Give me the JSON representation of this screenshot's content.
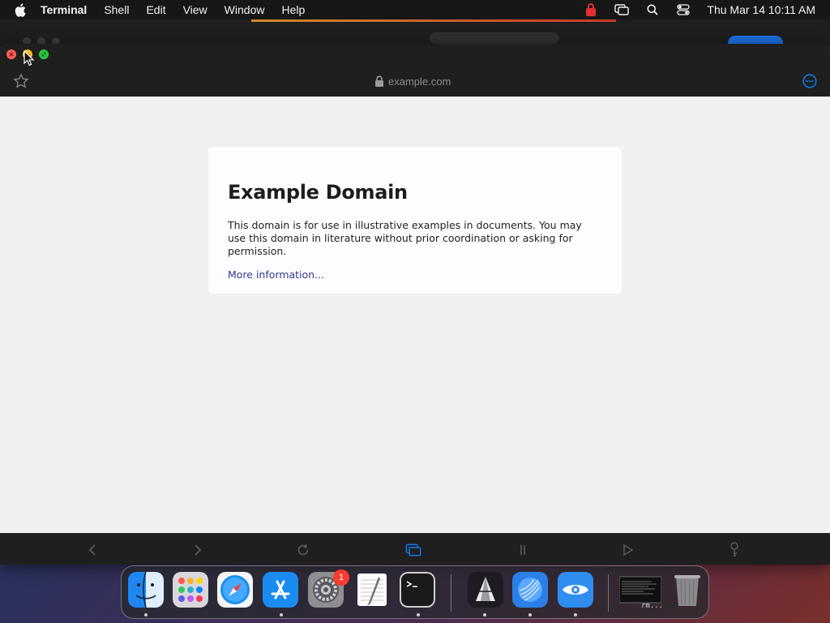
{
  "menubar": {
    "app_name": "Terminal",
    "items": [
      "Shell",
      "Edit",
      "View",
      "Window",
      "Help"
    ],
    "clock": "Thu Mar 14  10:11 AM",
    "status_icons": [
      "recording-indicator-icon",
      "screen-mirroring-icon",
      "spotlight-search-icon",
      "control-center-icon"
    ]
  },
  "browser": {
    "address": "example.com",
    "page": {
      "heading": "Example Domain",
      "body": "This domain is for use in illustrative examples in documents. You may use this domain in literature without prior coordination or asking for permission.",
      "link": "More information..."
    },
    "bottom_toolbar": [
      "back-icon",
      "forward-icon",
      "reload-icon",
      "tabs-icon",
      "reader-pause-icon",
      "play-icon",
      "key-icon"
    ],
    "accent_color": "#0a84ff"
  },
  "dock": {
    "apps": [
      "Finder",
      "Launchpad",
      "Safari",
      "App Store",
      "System Settings",
      "TextEdit",
      "Terminal",
      "Ultra",
      "Network Radar",
      "Preview"
    ],
    "system_settings_badge": "1",
    "minimized_window_label": "rm..."
  }
}
